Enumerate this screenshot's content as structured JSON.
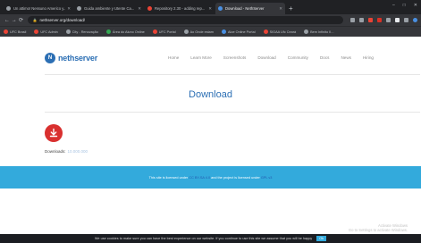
{
  "browser": {
    "tabs": [
      {
        "label": "Un attimo! Nessuno Americo y...",
        "color": "#9aa0a6",
        "active": false
      },
      {
        "label": "Guida ambiente y Utente Ca...",
        "color": "#9aa0a6",
        "active": false
      },
      {
        "label": "Repository 2.30 - adding rep...",
        "color": "#ea4335",
        "active": false
      },
      {
        "label": "Download - NethServer",
        "color": "#4a90e2",
        "active": true
      }
    ],
    "new_tab": "+",
    "window_controls": [
      "–",
      "□",
      "✕"
    ],
    "nav": {
      "back": "←",
      "forward": "→",
      "reload": "⟳"
    },
    "url": "nethserver.org/download/",
    "extension_colors": [
      "#9aa0a6",
      "#9aa0a6",
      "#ea4335",
      "#d93025",
      "#9aa0a6",
      "#e8eaed",
      "#9aa0a6",
      "#4a90e2"
    ],
    "bookmarks": [
      {
        "label": "UFC Brasil",
        "color": "#ea4335"
      },
      {
        "label": "UFC Admin",
        "color": "#ea4335"
      },
      {
        "label": "City - Renovação",
        "color": "#9aa0a6"
      },
      {
        "label": "Área do Aluno Online",
        "color": "#34a853"
      },
      {
        "label": "UFC Portal",
        "color": "#ea4335"
      },
      {
        "label": "Ao Onde estam",
        "color": "#9aa0a6"
      },
      {
        "label": "Aloe Online Portal",
        "color": "#4a90e2"
      },
      {
        "label": "SIGAA Ufc Ceará",
        "color": "#ea4335"
      },
      {
        "label": "Bem Infinito II...",
        "color": "#9aa0a6"
      }
    ]
  },
  "site": {
    "logo_letter": "N",
    "logo_text": "nethserver",
    "nav": [
      "Home",
      "Learn More",
      "Screenshots",
      "Download",
      "Community",
      "Docs",
      "News",
      "Hiring"
    ],
    "page_title": "Download",
    "downloads_label": "Downloads:",
    "downloads_count": "10.000.000",
    "band_text_1": "This site is licensed under",
    "band_link_1": "CC BY-SA 4.0",
    "band_text_2": "and the project is licensed under",
    "band_link_2": "GPL v3",
    "watermark_line1": "Activate Windows",
    "watermark_line2": "Go to Settings to activate Windows.",
    "cookie_text": "We use cookies to make sure you can have the best experience on our website. If you continue to use this site we assume that you will be happy",
    "cookie_button": "Ok"
  }
}
